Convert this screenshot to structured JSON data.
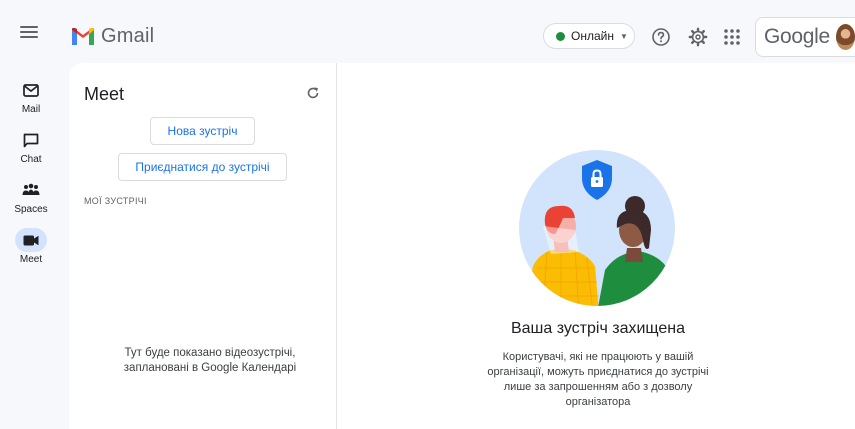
{
  "app": {
    "name": "Gmail"
  },
  "header": {
    "status_label": "Онлайн",
    "google_label": "Google"
  },
  "rail": {
    "items": [
      {
        "label": "Mail",
        "icon": "mail-icon"
      },
      {
        "label": "Chat",
        "icon": "chat-icon"
      },
      {
        "label": "Spaces",
        "icon": "spaces-icon"
      },
      {
        "label": "Meet",
        "icon": "video-icon",
        "active": true
      }
    ]
  },
  "meet": {
    "title": "Meet",
    "new_meeting_label": "Нова зустріч",
    "join_meeting_label": "Приєднатися до зустрічі",
    "my_meetings_label": "МОЇ ЗУСТРІЧІ",
    "empty_state": "Тут буде показано відеозустрічі, заплановані в Google Календарі"
  },
  "security": {
    "title": "Ваша зустріч захищена",
    "description": "Користувачі, які не працюють у вашій організації, можуть приєднатися до зустрічі лише за запрошенням або з дозволу організатора"
  },
  "colors": {
    "accent": "#1a73e8",
    "online": "#1e8e3e",
    "background": "#f6f8fc",
    "rail_active": "#d3e3fd"
  }
}
